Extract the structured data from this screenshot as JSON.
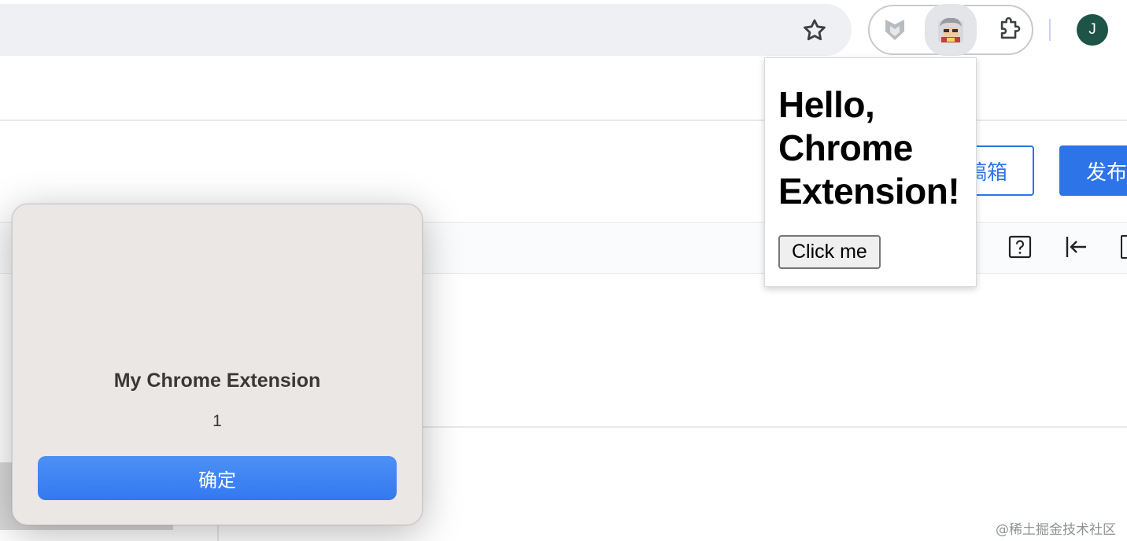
{
  "toolbar": {
    "bookmark_icon": "star-icon",
    "extensions": [
      {
        "name": "shield-extension-icon"
      },
      {
        "name": "my-chrome-extension-icon"
      },
      {
        "name": "puzzle-extensions-icon"
      }
    ],
    "avatar_letter": "J",
    "avatar_color": "#1d5447"
  },
  "page": {
    "drafts_label": "稿箱",
    "publish_label": "发布",
    "accent_color": "#2d74e8",
    "tools": [
      {
        "name": "help-icon"
      },
      {
        "name": "collapse-left-icon"
      }
    ],
    "watermark": "@稀土掘金技术社区"
  },
  "popup": {
    "heading": "Hello, Chrome Extension!",
    "button_label": "Click me"
  },
  "alert": {
    "title": "My Chrome Extension",
    "message": "1",
    "ok_label": "确定",
    "ok_color": "#3478f0"
  }
}
